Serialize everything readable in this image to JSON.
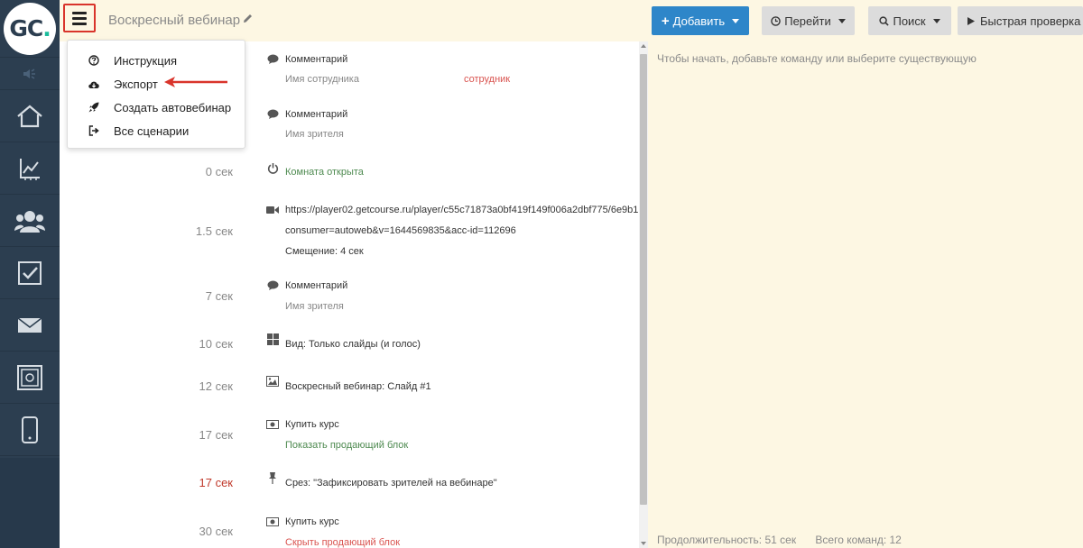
{
  "app": {
    "logo_text": "GC",
    "logo_dot": "."
  },
  "colors": {
    "sidebar_bg": "#2c3e50",
    "accent": "#2e86c9",
    "logo_dot": "#1abc9c",
    "highlight_red": "#d9342b",
    "green_text": "#4e8a50",
    "red_text": "#d9534f",
    "panel_bg": "#fdf7e3"
  },
  "sidebar": {
    "items": [
      {
        "icon": "speaker-icon"
      },
      {
        "icon": "home-icon"
      },
      {
        "icon": "chart-icon"
      },
      {
        "icon": "users-icon"
      },
      {
        "icon": "checkbox-icon"
      },
      {
        "icon": "mail-icon"
      },
      {
        "icon": "safe-icon"
      },
      {
        "icon": "phone-icon"
      }
    ]
  },
  "header": {
    "title": "Воскресный вебинар",
    "add_label": "Добавить",
    "go_label": "Перейти",
    "search_label": "Поиск",
    "quick_check_label": "Быстрая проверка"
  },
  "menu": {
    "items": [
      {
        "label": "Инструкция",
        "icon": "question-circle-icon"
      },
      {
        "label": "Экспорт",
        "icon": "cloud-download-icon"
      },
      {
        "label": "Создать автовебинар",
        "icon": "rocket-icon"
      },
      {
        "label": "Все сценарии",
        "icon": "sign-out-icon"
      }
    ]
  },
  "timeline": {
    "rows": [
      {
        "time": "",
        "icon": "comment-icon",
        "text": "Комментарий",
        "sub": "Имя сотрудника",
        "extra": "сотрудник"
      },
      {
        "time": "",
        "icon": "comment-icon",
        "text": "Комментарий",
        "sub": "Имя зрителя"
      },
      {
        "time": "0 сек",
        "icon": "power-icon",
        "text": "Комната открыта"
      },
      {
        "time": "1.5 сек",
        "icon": "video-icon",
        "text": "https://player02.getcourse.ru/player/c55c71873a0bf419f149f006a2dbf775/6e9b1",
        "line2": "consumer=autoweb&v=1644569835&acc-id=112696",
        "line3": "Смещение: 4 сек"
      },
      {
        "time": "7 сек",
        "icon": "comment-icon",
        "text": "Комментарий",
        "sub": "Имя зрителя"
      },
      {
        "time": "10 сек",
        "icon": "grid-icon",
        "text": "Вид: Только слайды (и голос)"
      },
      {
        "time": "12 сек",
        "icon": "image-icon",
        "text": "Воскресный вебинар: Слайд #1"
      },
      {
        "time": "17 сек",
        "icon": "money-icon",
        "text": "Купить курс",
        "sub": "Показать продающий блок"
      },
      {
        "time": "17 сек",
        "icon": "pin-icon",
        "text": "Срез: \"Зафиксировать зрителей на вебинаре\""
      },
      {
        "time": "30 сек",
        "icon": "money-icon",
        "text": "Купить курс",
        "sub": "Скрыть продающий блок"
      }
    ]
  },
  "right_panel": {
    "hint": "Чтобы начать, добавьте команду или выберите существующую",
    "duration": "Продолжительность: 51 сек",
    "total_commands": "Всего команд: 12"
  }
}
